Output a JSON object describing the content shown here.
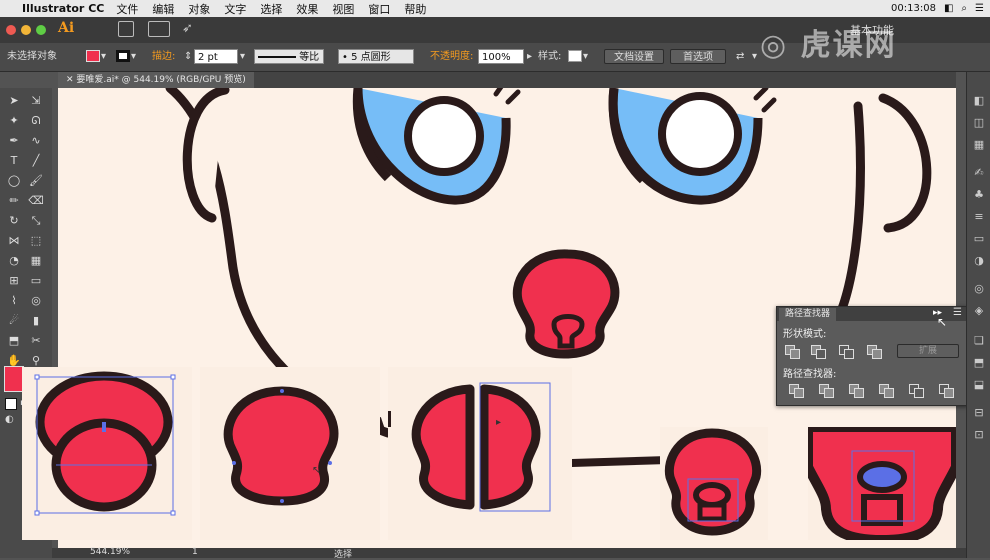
{
  "menubar": {
    "app_name": "Illustrator CC",
    "items": [
      "文件",
      "编辑",
      "对象",
      "文字",
      "选择",
      "效果",
      "视图",
      "窗口",
      "帮助"
    ],
    "clock": "00:13:08"
  },
  "appbar": {
    "logo": "Ai",
    "workspace_label": "基本功能"
  },
  "control": {
    "selection_label": "未选择对象",
    "fill_color": "#f0304e",
    "stroke_label": "描边:",
    "stroke_value": "2 pt",
    "stroke_profile": "等比",
    "brush_label": "5 点圆形",
    "opacity_label": "不透明度:",
    "opacity_value": "100%",
    "style_label": "样式:",
    "doc_settings_button": "文档设置",
    "preferences_button": "首选项"
  },
  "document": {
    "tab_title": "要唯爱.ai* @ 544.19% (RGB/GPU 预览)"
  },
  "pathfinder": {
    "title": "路径查找器",
    "shape_modes_label": "形状模式:",
    "expand_button": "扩展",
    "pathfinders_label": "路径查找器:"
  },
  "status": {
    "zoom": "544.19%",
    "page": "1",
    "tool": "选择"
  },
  "watermark": {
    "text": "虎课网"
  },
  "colors": {
    "accent_red": "#f0304e",
    "outline": "#2a1a1a",
    "eye_blue": "#76bdf7",
    "skin": "#fdf1e7",
    "selection_blue": "#5b6fe6"
  }
}
